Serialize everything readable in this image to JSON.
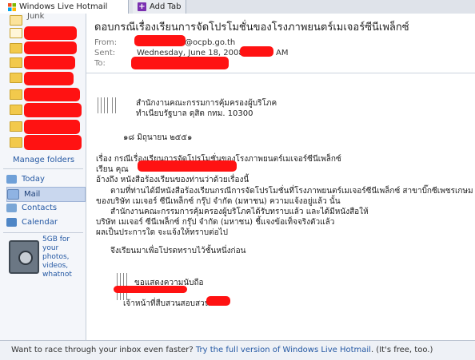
{
  "tabs": {
    "active_title": "Windows Live Hotmail",
    "add_tab_label": "Add Tab"
  },
  "sidebar": {
    "junk_label": "Junk",
    "manage_folders": "Manage folders",
    "nav": [
      {
        "label": "Today"
      },
      {
        "label": "Mail"
      },
      {
        "label": "Contacts"
      },
      {
        "label": "Calendar"
      }
    ],
    "promo_text": "5GB for your photos, videos, whatnot"
  },
  "message": {
    "subject": "ดอบกรณีเรื่องเรียนการจัดโปรโมชั่นของโรงภาพยนตร์เมเจอร์ซีนีเพล็กซ์",
    "from_label": "From:",
    "from_value": "@ocpb.go.th",
    "sent_label": "Sent:",
    "sent_value": "Wednesday, June 18, 2008",
    "sent_ampm": "AM",
    "to_label": "To:",
    "body": {
      "org_line1": "สำนักงานคณะกรรมการคุ้มครองผู้บริโภค",
      "org_line2": "ทำเนียบรัฐบาล ดุสิต กทม. 10300",
      "date": "๑๘ มิถุนายน ๒๕๕๑",
      "subject_line": "เรื่อง   กรณีเรื่องเรียนการจัดโปรโมชั่นของโรงภาพยนตร์เมเจอร์ซีนีเพล็กซ์",
      "dear_line": "เรียน   คุณ",
      "ref_line": "อ้างถึง   หนังสือร้องเรียนของท่านว่าด้วยเรื่องนี้",
      "para1_line1": "ตามที่ท่านได้มีหนังสือร้องเรียนกรณีการจัดโปรโมชั่นที่โรงภาพยนตร์เมเจอร์ซีนีเพล็กซ์ สาขาบิ๊กซีเพชรเกษม",
      "para1_line2": "ของบริษัท เมเจอร์ ซีนีเพล็กซ์ กรุ๊ป จำกัด (มหาชน) ความแจ้งอยู่แล้ว นั้น",
      "para2_line1": "สำนักงานคณะกรรมการคุ้มครองผู้บริโภคได้รับทราบแล้ว และได้มีหนังสือให้",
      "para2_line2": "บริษัท เมเจอร์ ซีนีเพล็กซ์ กรุ๊ป จำกัด (มหาชน) ชี้แจงข้อเท็จจริงตัวแล้ว",
      "para2_line3": "ผลเป็นประการใด จะแจ้งให้ทราบต่อไป",
      "closing": "จึงเรียนมาเพื่อโปรดทราบไว้ชั้นหนึ่งก่อน",
      "regards": "ขอแสดงความนับถือ",
      "officer": "เจ้าหน้าที่สืบสวนสอบสวน"
    }
  },
  "bottom_bar": {
    "prefix": "Want to race through your inbox even faster?",
    "link": "Try the full version of Windows Live Hotmail",
    "suffix": ". (It's free, too.)"
  }
}
